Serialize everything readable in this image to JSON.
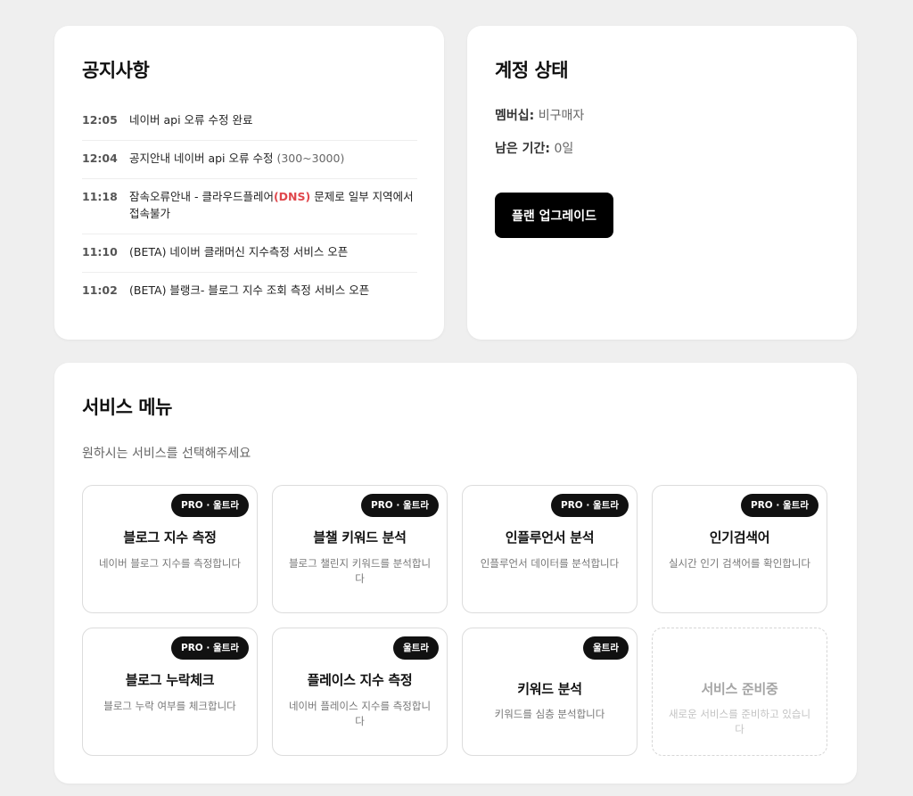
{
  "notice": {
    "title": "공지사항",
    "items": [
      {
        "time": "12:05",
        "text": "네이버 api 오류 수정 완료"
      },
      {
        "time": "12:04",
        "text": "공지안내 네이버 api 오류 수정 ",
        "muted": "(300~3000)"
      },
      {
        "time": "11:18",
        "text_before": "잠속오류안내 - 클라우드플레어",
        "highlight": "(DNS)",
        "text_after": " 문제로 일부 지역에서 접속불가"
      },
      {
        "time": "11:10",
        "text": "(BETA) 네이버 클래머신 지수측정 서비스 오픈"
      },
      {
        "time": "11:02",
        "text": "(BETA) 블랭크- 블로그 지수 조회 측정 서비스 오픈"
      }
    ]
  },
  "account": {
    "title": "계정 상태",
    "membership_label": "멤버십:",
    "membership_value": "비구매자",
    "remaining_label": "남은 기간:",
    "remaining_value": "0일",
    "upgrade_label": "플랜 업그레이드"
  },
  "services": {
    "title": "서비스 메뉴",
    "subtitle": "원하시는 서비스를 선택해주세요",
    "tiles": [
      {
        "badge": "PRO · 울트라",
        "name": "블로그 지수 측정",
        "desc": "네이버 블로그 지수를 측정합니다"
      },
      {
        "badge": "PRO · 울트라",
        "name": "블챌 키워드 분석",
        "desc": "블로그 챌린지 키워드를 분석합니다"
      },
      {
        "badge": "PRO · 울트라",
        "name": "인플루언서 분석",
        "desc": "인플루언서 데이터를 분석합니다"
      },
      {
        "badge": "PRO · 울트라",
        "name": "인기검색어",
        "desc": "실시간 인기 검색어를 확인합니다"
      },
      {
        "badge": "PRO · 울트라",
        "name": "블로그 누락체크",
        "desc": "블로그 누락 여부를 체크합니다"
      },
      {
        "badge": "울트라",
        "name": "플레이스 지수 측정",
        "desc": "네이버 플레이스 지수를 측정합니다"
      },
      {
        "badge": "울트라",
        "name": "키워드 분석",
        "desc": "키워드를 심층 분석합니다"
      },
      {
        "name": "서비스 준비중",
        "desc": "새로운 서비스를 준비하고 있습니다"
      }
    ]
  }
}
